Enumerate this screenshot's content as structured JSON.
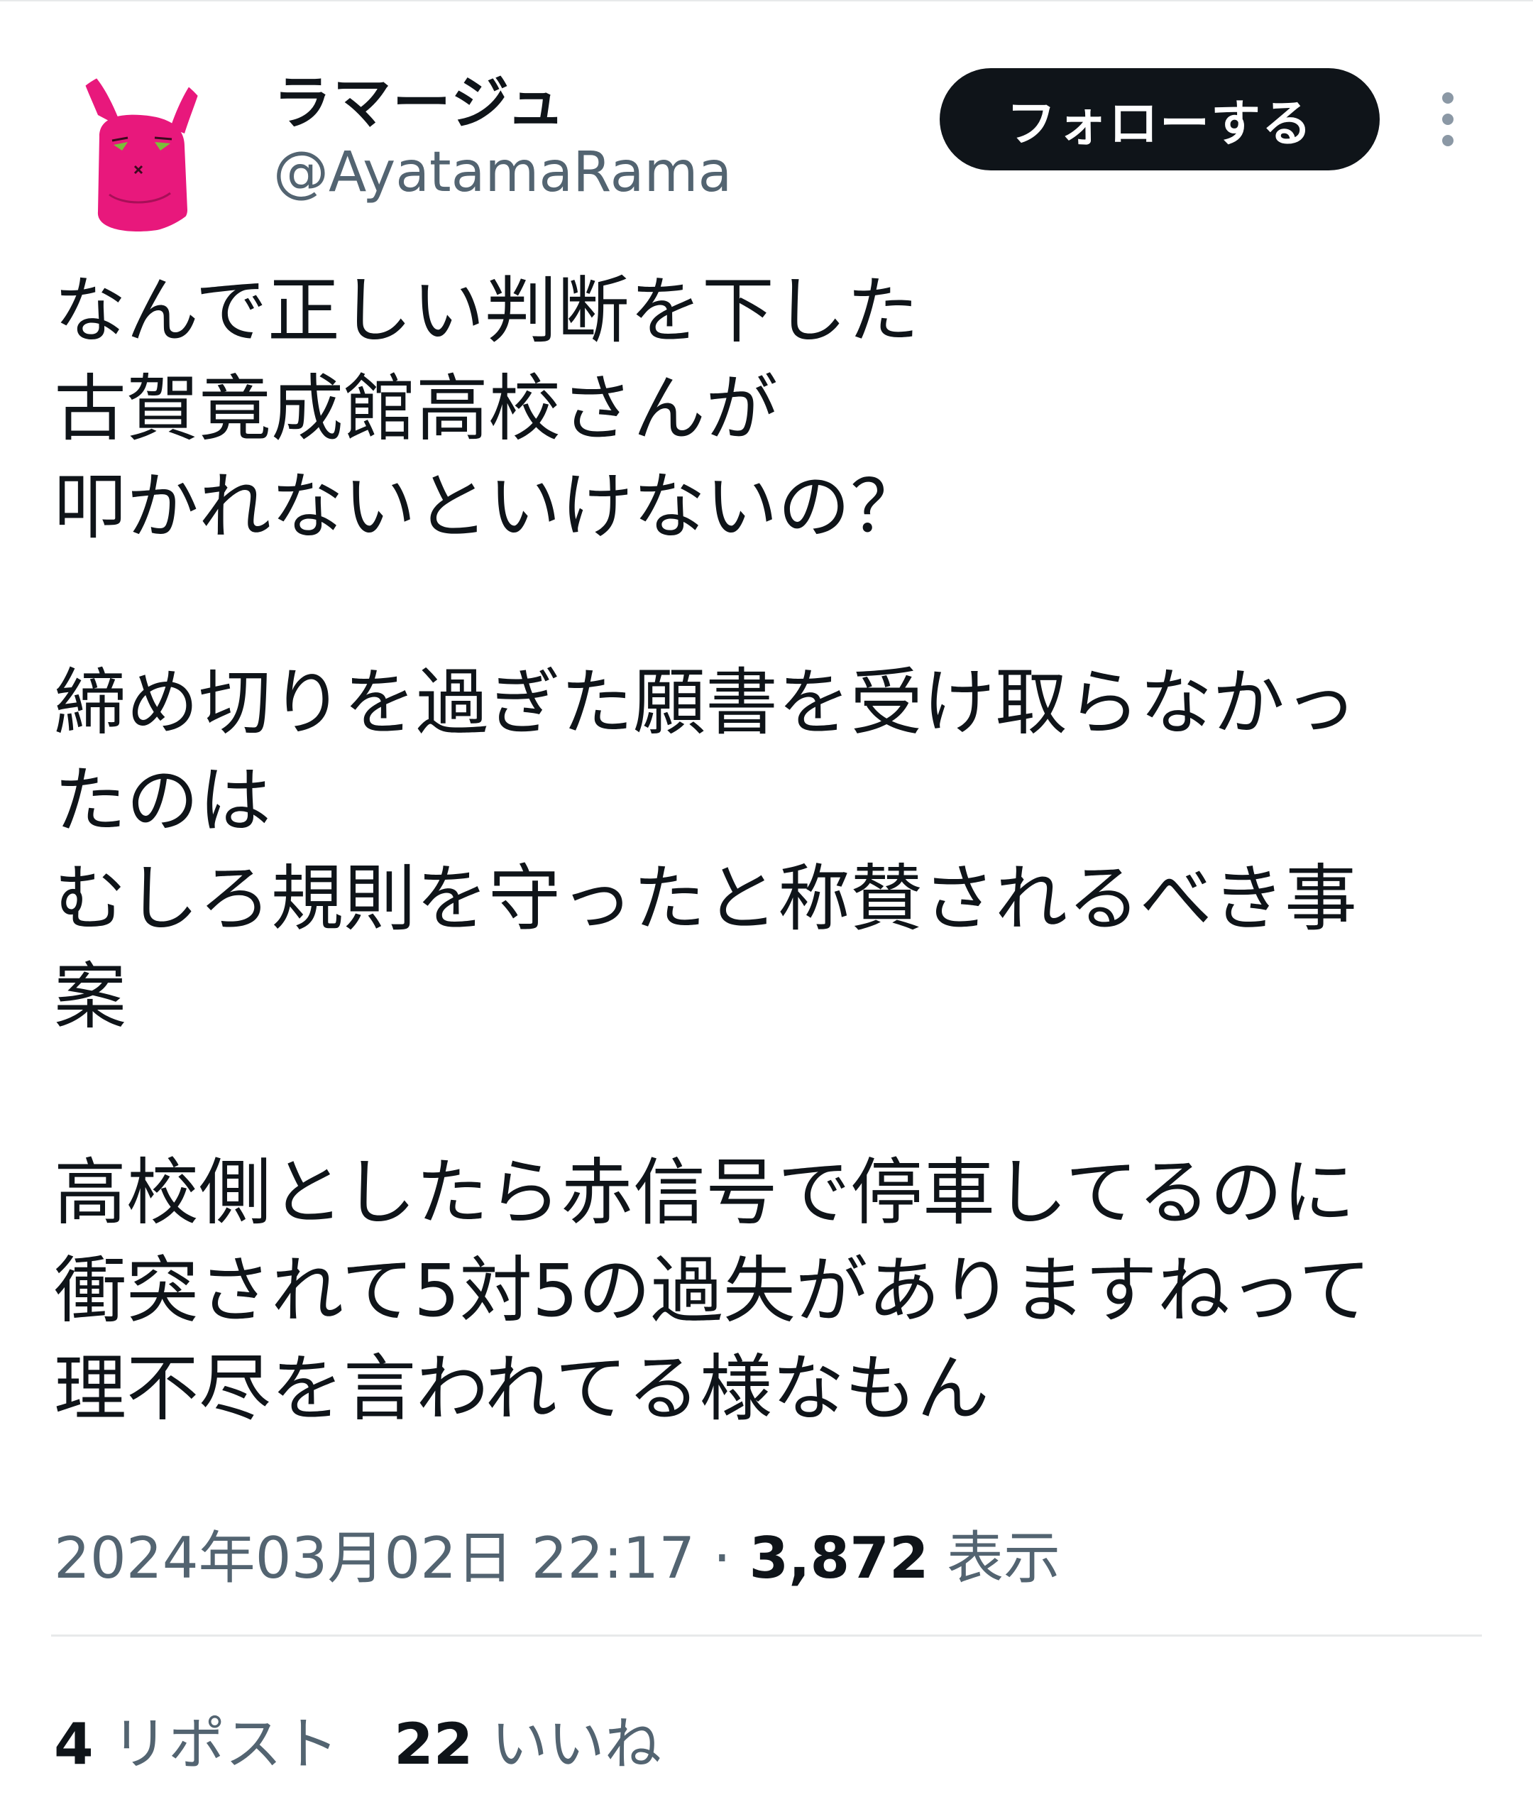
{
  "colors": {
    "text_primary": "#0f1419",
    "text_secondary": "#536471",
    "follow_button_bg": "#0f1419",
    "follow_button_text": "#ffffff",
    "divider": "#e7e9ea",
    "avatar_pink": "#e8187c",
    "avatar_green": "#7bbf3a"
  },
  "author": {
    "display_name": "ラマージュ",
    "handle": "@AyatamaRama",
    "avatar_icon": "pink-rabbit-avatar-icon"
  },
  "actions": {
    "follow_label": "フォローする",
    "more_icon": "more-vertical-icon"
  },
  "tweet": {
    "lines": [
      "なんで正しい判断を下した",
      "古賀竟成館高校さんが",
      "叩かれないといけないの？",
      "",
      "締め切りを過ぎた願書を受け取らなかっ",
      "たのは",
      "むしろ規則を守ったと称賛されるべき事",
      "案",
      "",
      "高校側としたら赤信号で停車してるのに",
      "衝突されて5対5の過失がありますねって",
      "理不尽を言われてる様なもん"
    ]
  },
  "meta": {
    "timestamp": "2024年03月02日 22:17",
    "separator": " · ",
    "views_count": "3,872",
    "views_label": " 表示"
  },
  "stats": {
    "reposts_count": "4",
    "reposts_label": " リポスト",
    "likes_count": "22",
    "likes_label": " いいね"
  }
}
